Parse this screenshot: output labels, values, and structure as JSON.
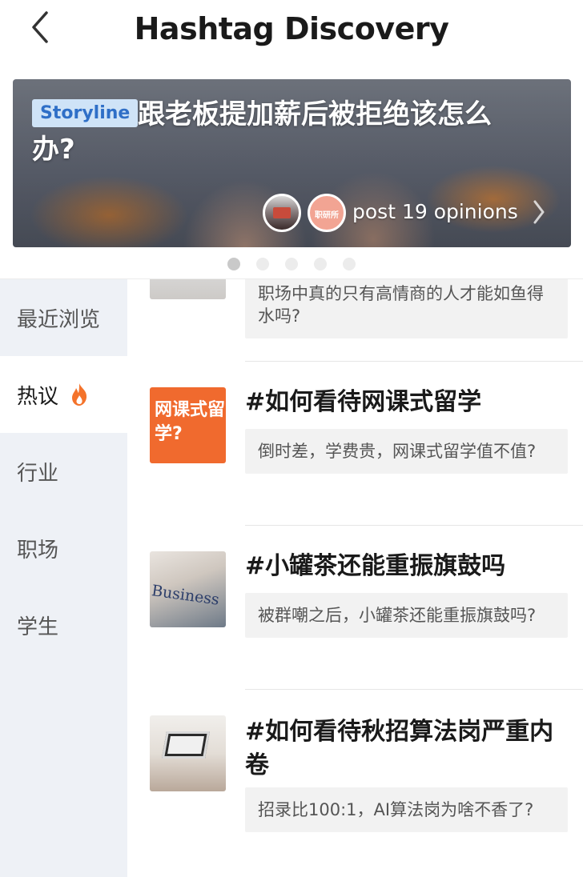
{
  "header": {
    "title": "Hashtag Discovery",
    "back_icon": "chevron-left-icon"
  },
  "banner": {
    "badge": "Storyline",
    "title": "跟老板提加薪后被拒绝该怎么办?",
    "opinions_text": "post 19 opinions",
    "avatar_2_label": "职研所",
    "chevron_icon": "chevron-right-icon"
  },
  "carousel": {
    "count": 5,
    "active_index": 0
  },
  "sidebar": {
    "items": [
      {
        "label": "最近浏览",
        "active": false
      },
      {
        "label": "热议",
        "active": true,
        "icon": "fire-icon"
      },
      {
        "label": "行业",
        "active": false
      },
      {
        "label": "职场",
        "active": false
      },
      {
        "label": "学生",
        "active": false
      }
    ],
    "accent_color": "#f4732b"
  },
  "topics": [
    {
      "desc": "职场中真的只有高情商的人才能如鱼得水吗?"
    },
    {
      "title": "#如何看待网课式留学",
      "thumb_text": "网课式留学?",
      "desc": "倒时差，学费贵，网课式留学值不值?"
    },
    {
      "title": "#小罐茶还能重振旗鼓吗",
      "thumb_text": "Business",
      "desc": "被群嘲之后，小罐茶还能重振旗鼓吗?"
    },
    {
      "title": "#如何看待秋招算法岗严重内卷",
      "desc": "招录比100:1，AI算法岗为啥不香了?"
    }
  ]
}
